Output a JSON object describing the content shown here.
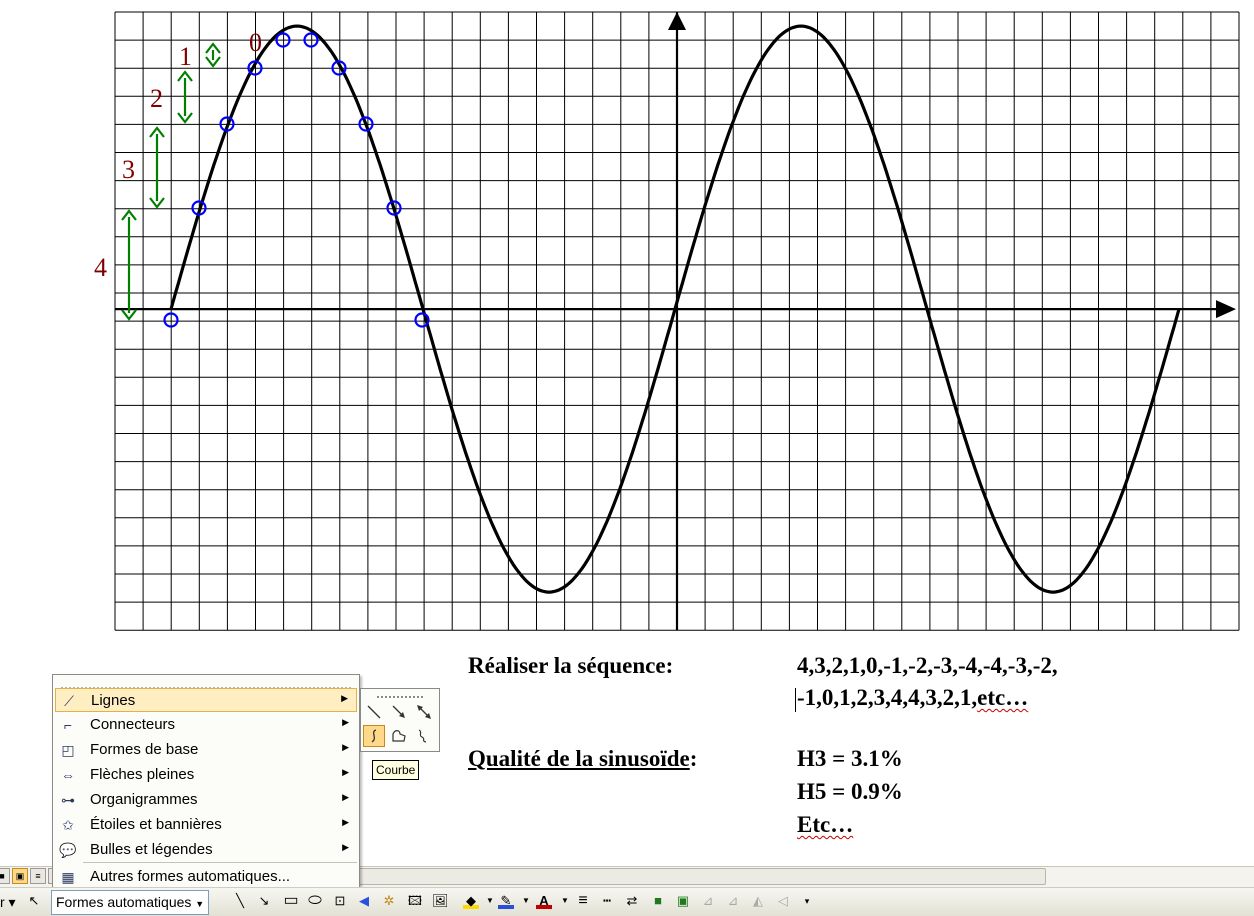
{
  "document": {
    "graph_step_labels": [
      "1",
      "2",
      "3",
      "4"
    ],
    "graph_zero_label": "0",
    "sequence_heading": "Réaliser la séquence:",
    "sequence_line1": "4,3,2,1,0,-1,-2,-3,-4,-4,-3,-2,",
    "sequence_line2_main": "-1,0,1,2,3,4,4,3,2,1,",
    "sequence_line2_etc": "etc…",
    "quality_heading": "Qualité de la sinusoïde",
    "quality_colon": ":",
    "h3": "H3 = 3.1%",
    "h5": "H5 = 0.9%",
    "etc": "Etc…"
  },
  "autoshapes_menu": {
    "items": [
      {
        "label": "Lignes",
        "icon": "lines-icon",
        "has_submenu": true,
        "highlighted": true
      },
      {
        "label": "Connecteurs",
        "icon": "connectors-icon",
        "has_submenu": true
      },
      {
        "label": "Formes de base",
        "icon": "basic-shapes-icon",
        "has_submenu": true
      },
      {
        "label": "Flèches pleines",
        "icon": "block-arrows-icon",
        "has_submenu": true
      },
      {
        "label": "Organigrammes",
        "icon": "flowchart-icon",
        "has_submenu": true
      },
      {
        "label": "Étoiles et bannières",
        "icon": "stars-banners-icon",
        "has_submenu": true
      },
      {
        "label": "Bulles et légendes",
        "icon": "callouts-icon",
        "has_submenu": true
      },
      {
        "label": "Autres formes automatiques...",
        "icon": "more-autoshapes-icon",
        "has_submenu": false
      }
    ]
  },
  "lines_submenu": {
    "tools": [
      "line-icon",
      "arrow-icon",
      "double-arrow-icon",
      "curve-icon",
      "freeform-icon",
      "scribble-icon"
    ],
    "selected": "curve-icon",
    "tooltip": "Courbe"
  },
  "drawing_toolbar": {
    "partial_label": "r",
    "autoshapes_label": "Formes automatiques",
    "icons": [
      "line-icon",
      "arrow-icon",
      "rectangle-icon",
      "oval-icon",
      "textbox-icon",
      "wordart-icon",
      "diagram-icon",
      "clipart-icon",
      "picture-icon",
      "fill-color-icon",
      "line-color-icon",
      "font-color-icon",
      "line-style-icon",
      "dash-style-icon",
      "arrow-style-icon",
      "shadow-icon",
      "3d-icon"
    ],
    "colors": {
      "fill": "#ffd800",
      "line": "#2a4fd8",
      "font": "#c00000"
    }
  },
  "colors": {
    "curve": "#000000",
    "grid": "#000000",
    "markers": "#0000ff",
    "arrows": "#008000",
    "step_labels": "#800000",
    "menu_highlight": "#ffeec2"
  }
}
